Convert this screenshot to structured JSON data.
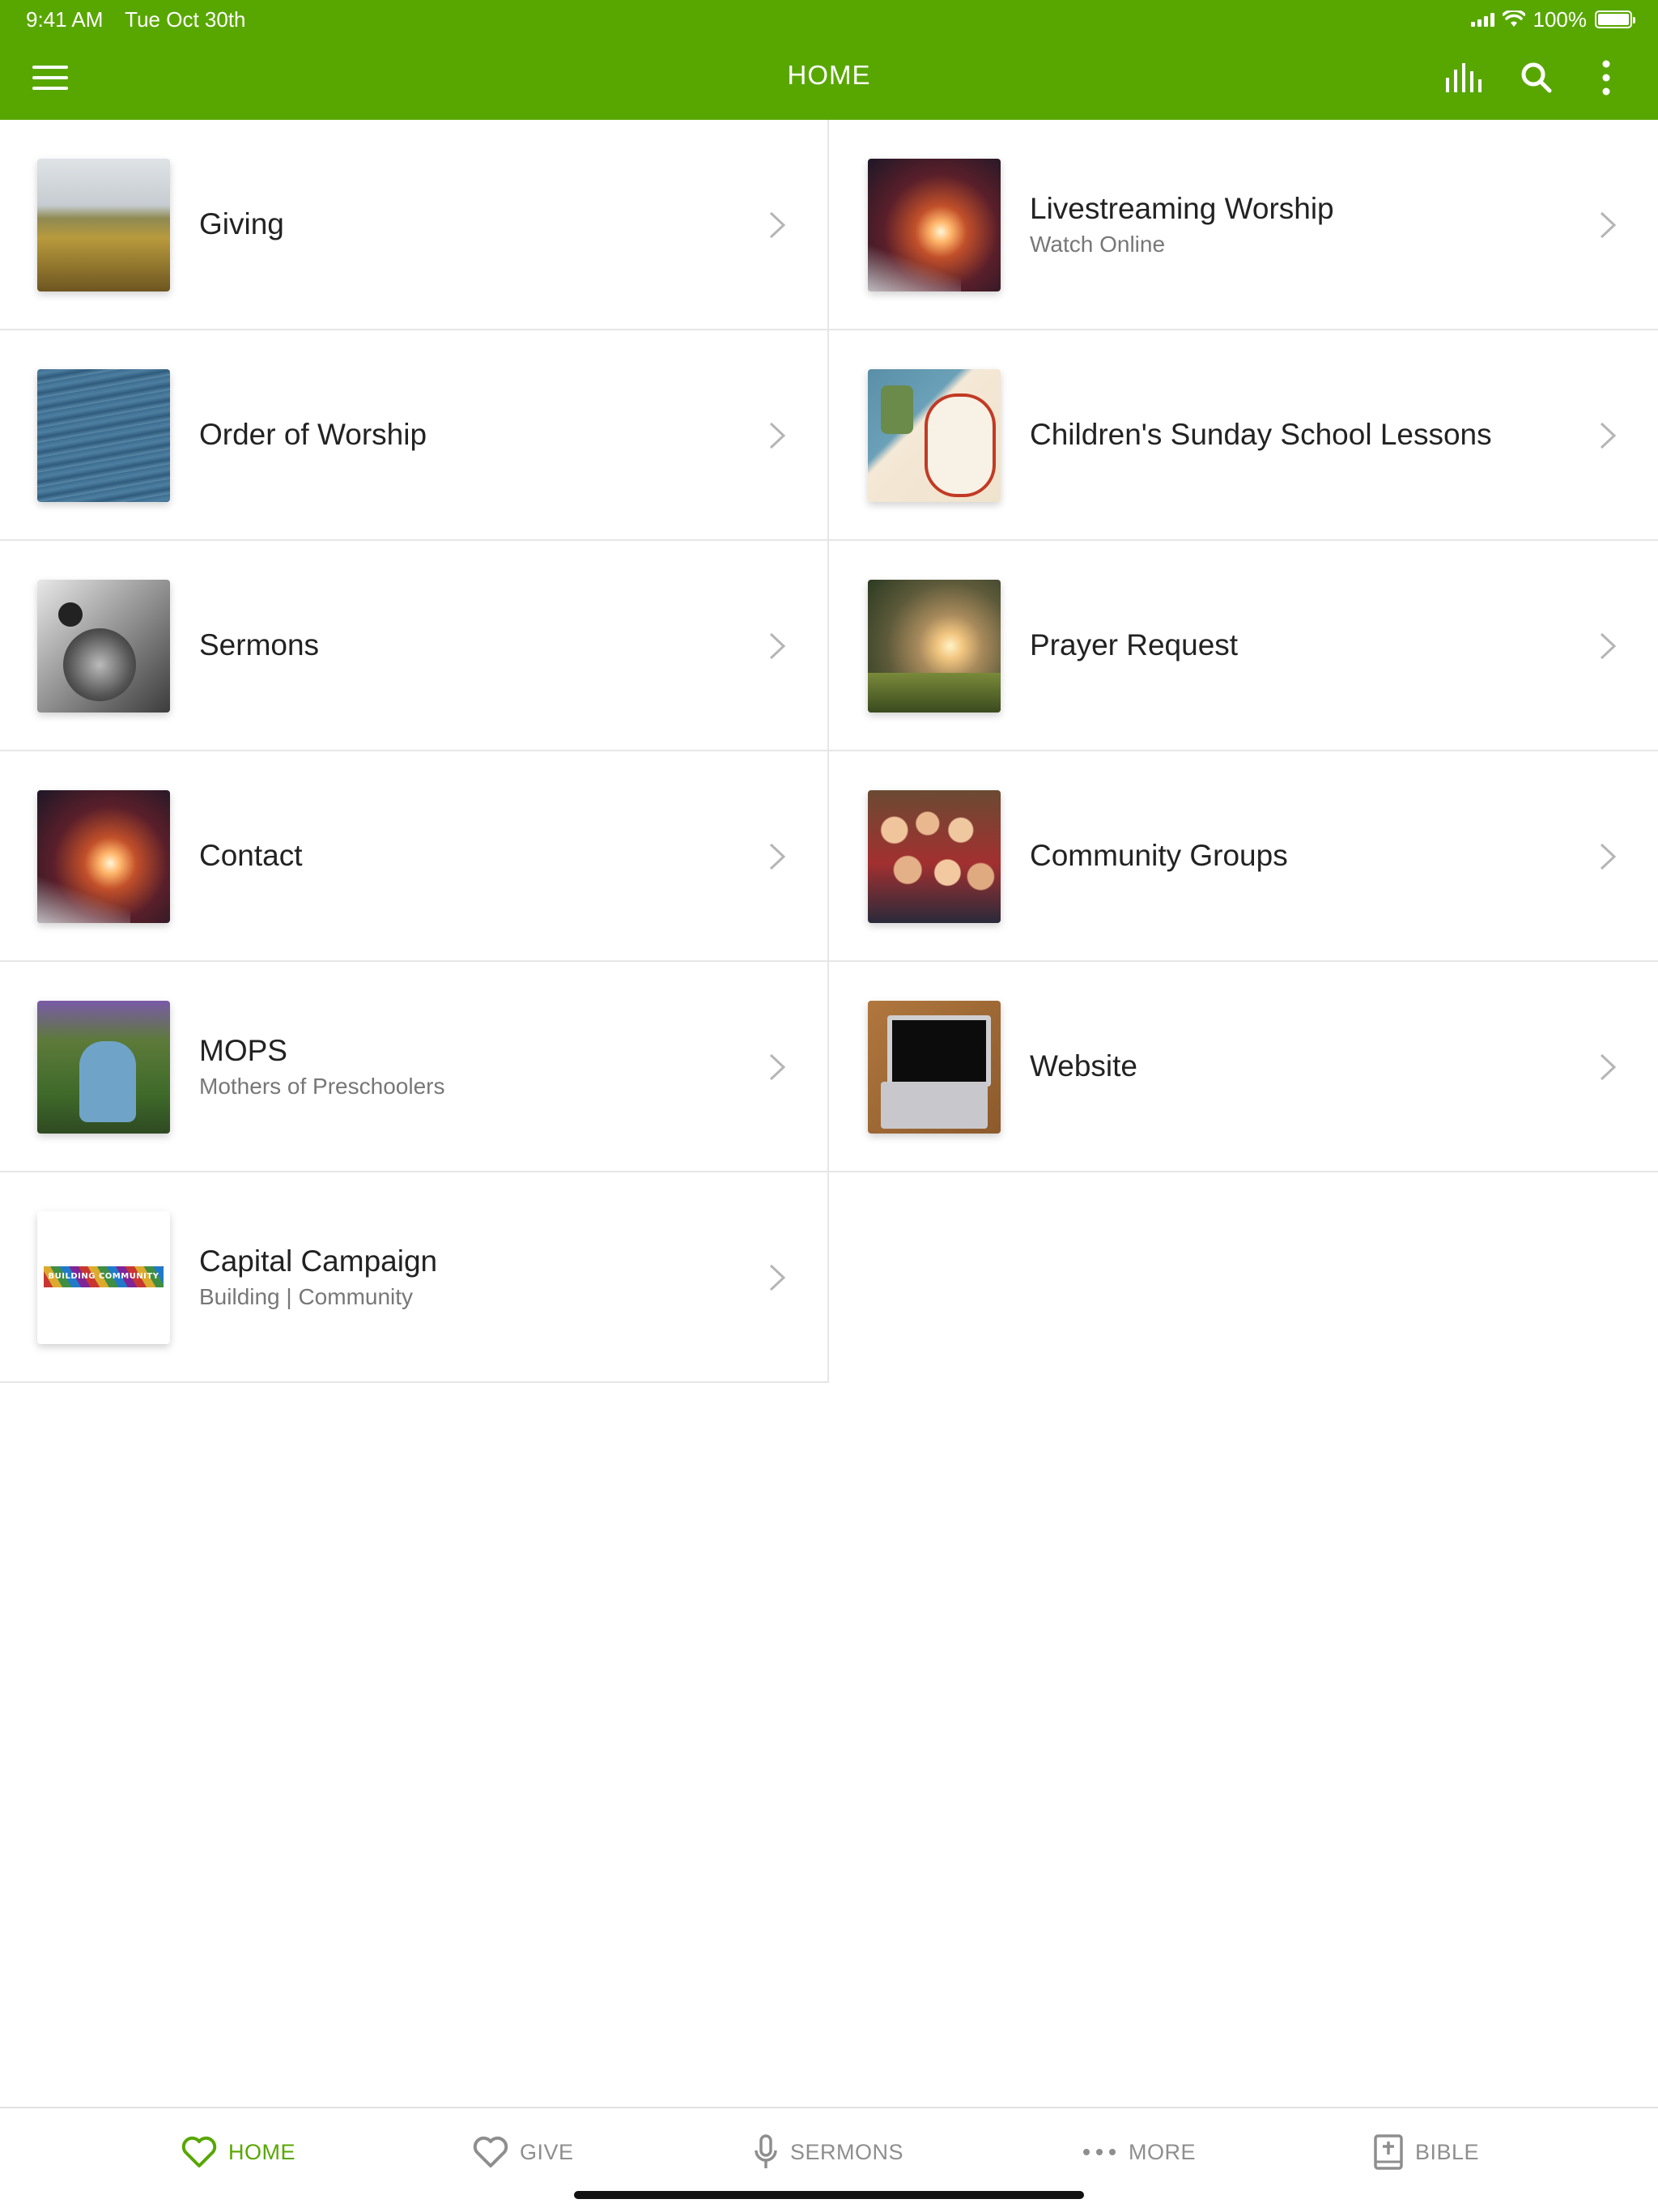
{
  "status_bar": {
    "time": "9:41 AM",
    "date": "Tue Oct 30th",
    "battery": "100%"
  },
  "header": {
    "title": "HOME",
    "accent_color": "#58a700",
    "icons": [
      "menu-icon",
      "live-stats-icon",
      "search-icon",
      "more-vertical-icon"
    ]
  },
  "items": [
    {
      "title": "Giving",
      "subtitle": "",
      "thumb": "wheat-field"
    },
    {
      "title": "Livestreaming Worship",
      "subtitle": "Watch Online",
      "thumb": "light-trails"
    },
    {
      "title": "Order of Worship",
      "subtitle": "",
      "thumb": "ocean-water"
    },
    {
      "title": "Children's Sunday School Lessons",
      "subtitle": "",
      "thumb": "illustration"
    },
    {
      "title": "Sermons",
      "subtitle": "",
      "thumb": "microphone"
    },
    {
      "title": "Prayer Request",
      "subtitle": "",
      "thumb": "sunset-field"
    },
    {
      "title": "Contact",
      "subtitle": "",
      "thumb": "light-trails"
    },
    {
      "title": "Community Groups",
      "subtitle": "",
      "thumb": "group-photo"
    },
    {
      "title": "MOPS",
      "subtitle": "Mothers of Preschoolers",
      "thumb": "mother-child"
    },
    {
      "title": "Website",
      "subtitle": "",
      "thumb": "laptop"
    },
    {
      "title": "Capital Campaign",
      "subtitle": "Building | Community",
      "thumb": "campaign-banner",
      "thumb_text": "BUILDING COMMUNITY"
    }
  ],
  "tabs": [
    {
      "label": "HOME",
      "icon": "heart-icon",
      "active": true
    },
    {
      "label": "GIVE",
      "icon": "heart-icon",
      "active": false
    },
    {
      "label": "SERMONS",
      "icon": "microphone-icon",
      "active": false
    },
    {
      "label": "MORE",
      "icon": "more-horizontal-icon",
      "active": false
    },
    {
      "label": "BIBLE",
      "icon": "bible-icon",
      "active": false
    }
  ]
}
